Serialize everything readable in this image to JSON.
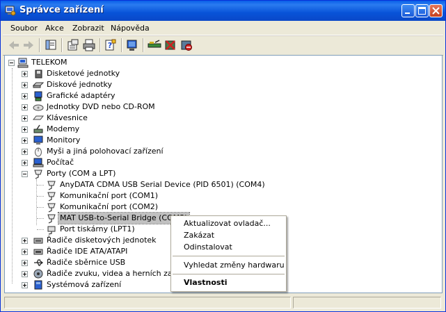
{
  "window": {
    "title": "Správce zařízení"
  },
  "menu": [
    "Soubor",
    "Akce",
    "Zobrazit",
    "Nápověda"
  ],
  "toolbar": [
    "back-icon",
    "forward-icon",
    "show-hide-tree-icon",
    "properties-icon",
    "print-icon",
    "help-icon",
    "scan-hardware-icon",
    "update-driver-icon",
    "uninstall-icon",
    "disable-icon"
  ],
  "tree": {
    "root": "TELEKOM",
    "items": [
      {
        "label": "Disketové jednotky",
        "icon": "floppy-icon"
      },
      {
        "label": "Diskové jednotky",
        "icon": "disk-icon"
      },
      {
        "label": "Grafické adaptéry",
        "icon": "display-adapter-icon"
      },
      {
        "label": "Jednotky DVD nebo CD-ROM",
        "icon": "cdrom-icon"
      },
      {
        "label": "Klávesnice",
        "icon": "keyboard-icon"
      },
      {
        "label": "Modemy",
        "icon": "modem-icon"
      },
      {
        "label": "Monitory",
        "icon": "monitor-icon"
      },
      {
        "label": "Myši a jiná polohovací zařízení",
        "icon": "mouse-icon"
      },
      {
        "label": "Počítač",
        "icon": "computer-icon"
      },
      {
        "label": "Porty (COM a LPT)",
        "icon": "port-icon"
      }
    ],
    "ports": [
      "AnyDATA CDMA USB Serial Device (PID 6501) (COM4)",
      "Komunikační port (COM1)",
      "Komunikační port (COM2)",
      "MAT USB-to-Serial Bridge (COM3)",
      "Port tiskárny (LPT1)"
    ],
    "items_after": [
      {
        "label": "Řadiče disketových jednotek",
        "icon": "controller-icon"
      },
      {
        "label": "Řadiče IDE ATA/ATAPI",
        "icon": "ide-controller-icon"
      },
      {
        "label": "Řadiče sběrnice USB",
        "icon": "usb-icon"
      },
      {
        "label": "Řadiče zvuku, videa a herních zařízen",
        "icon": "sound-icon"
      },
      {
        "label": "Systémová zařízení",
        "icon": "system-icon"
      }
    ]
  },
  "context_menu": {
    "update": "Aktualizovat ovladač...",
    "disable": "Zakázat",
    "uninstall": "Odinstalovat",
    "scan": "Vyhledat změny hardwaru",
    "properties": "Vlastnosti"
  },
  "colors": {
    "title_bar": "#0a5fe8",
    "selection": "#c0c0c0",
    "window_bg": "#ece9d8"
  }
}
